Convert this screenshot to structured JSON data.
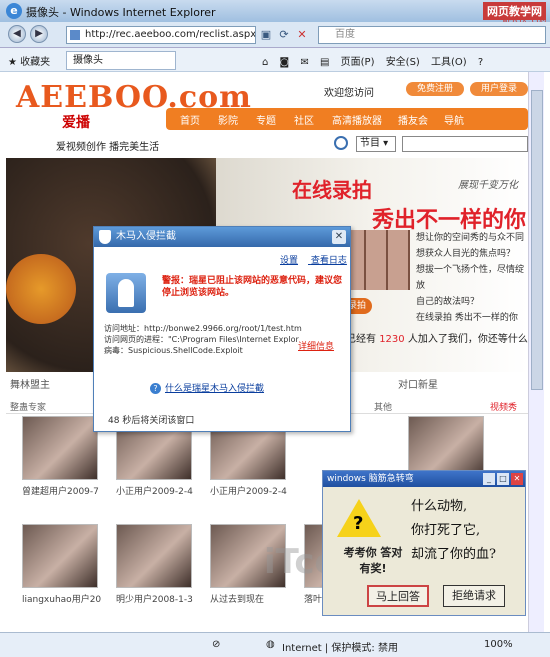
{
  "window": {
    "title": "摄像头 - Windows Internet Explorer",
    "watermark": "网页教学网",
    "watermark_url": "WEBJX.COM"
  },
  "address_bar": {
    "url": "http://rec.aeeboo.com/reclist.aspx?ty",
    "search_placeholder": "百度"
  },
  "tab_bar": {
    "favorites_label": "收藏夹",
    "tab_label": "摄像头",
    "tools": [
      "页面(P)",
      "安全(S)",
      "工具(O)"
    ]
  },
  "site": {
    "logo": "AEEBOO.com",
    "logo_sub": "爱播",
    "welcome": "欢迎您访问",
    "register": "免费注册",
    "login": "用户登录",
    "nav": [
      "首页",
      "影院",
      "专题",
      "社区",
      "高清播放器",
      "播友会",
      "导航"
    ],
    "slogan": "爱视频创作  播完美生活",
    "search_select": "节目"
  },
  "hero": {
    "line1": "在线录拍",
    "line2": "秀出不一样的你",
    "tag": "展现千变万化",
    "questions": [
      "想让你的空间秀的与众不同",
      "想获众人目光的焦点吗？",
      "想拔一个飞扬个性，尽情绽放",
      "自己的故法吗？",
      "在线录拍  秀出不一样的你"
    ],
    "join_button": "录拍",
    "joined_prefix": "已经有",
    "joined_count": "1230",
    "joined_suffix": "人加入了我们，你还等什么？"
  },
  "sections": {
    "left": "舞林盟主",
    "right": "对口新星",
    "categories": [
      "整蛊专家",
      "其他",
      "视频秀"
    ]
  },
  "videos": [
    {
      "caption": "曾建超用户2009-7"
    },
    {
      "caption": "小正用户2009-2-4"
    },
    {
      "caption": "小正用户2009-2-4"
    },
    {
      "caption": "liangxuhao用户20"
    },
    {
      "caption": "明少用户2008-1-3"
    },
    {
      "caption": "从过去到现在"
    },
    {
      "caption": "落叶"
    }
  ],
  "page_watermark": "iTcom.cn",
  "status_bar": {
    "zone": "Internet | 保护模式: 禁用",
    "zoom": "100%"
  },
  "popup": {
    "title": "木马入侵拦截",
    "settings": "设置",
    "log": "查看日志",
    "warning": "警报：瑞星已阻止该网站的恶意代码，建议您停止浏览该网站。",
    "addr_label": "访问地址：",
    "addr": "http://bonwe2.9966.org/root/1/test.htm",
    "proc_label": "访问网页的进程：",
    "proc": "\"C:\\Program Files\\Internet Explor",
    "virus_label": "病毒：",
    "virus": "Suspicious.ShellCode.Exploit",
    "detail": "详细信息",
    "help": "什么是瑞星木马入侵拦截",
    "closing": "48 秒后将关闭该窗口"
  },
  "joke": {
    "title": "windows 脑筋急转弯",
    "question": "考考你 答对有奖!",
    "riddle": [
      "什么动物,",
      "你打死了它,",
      "却流了你的血?"
    ],
    "ok": "马上回答",
    "no": "拒绝请求"
  }
}
